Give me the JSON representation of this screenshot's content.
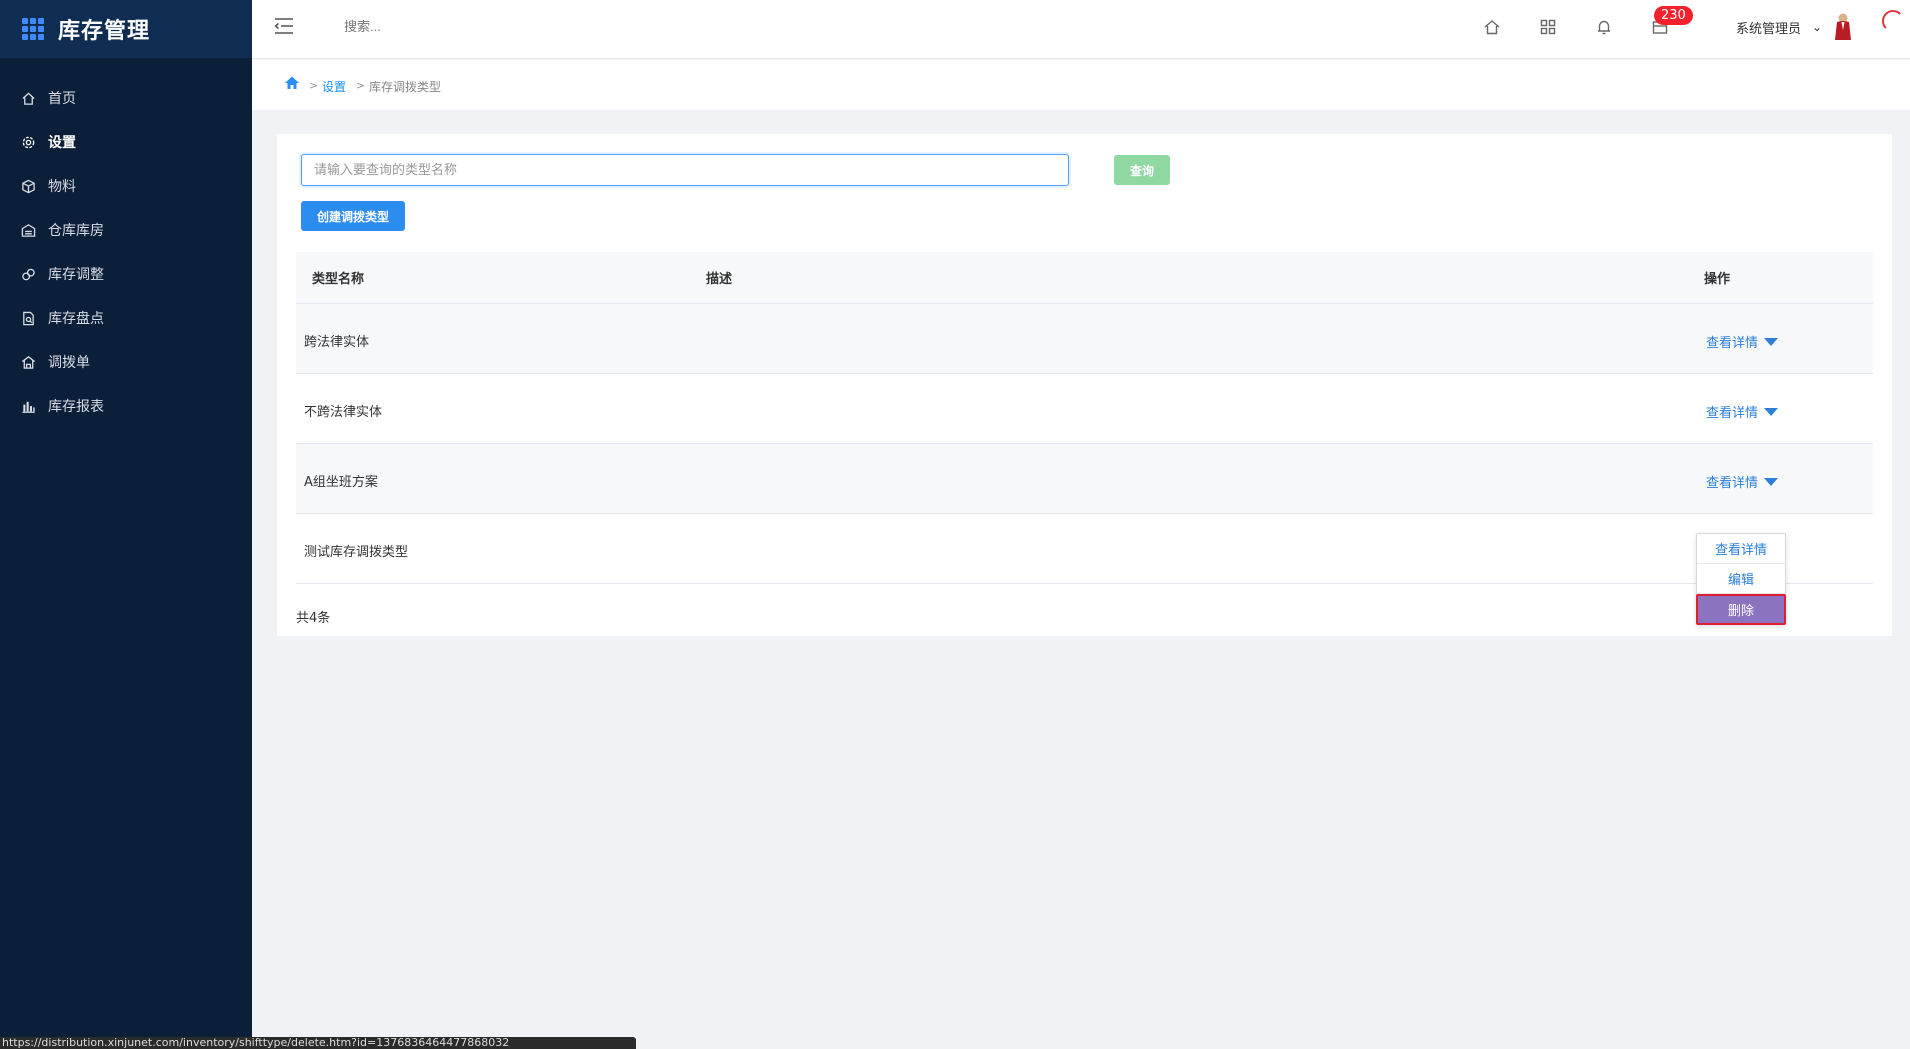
{
  "sidebar": {
    "title": "库存管理",
    "items": [
      {
        "label": "首页",
        "icon": "home-icon"
      },
      {
        "label": "设置",
        "icon": "gear-icon"
      },
      {
        "label": "物料",
        "icon": "box-icon"
      },
      {
        "label": "仓库库房",
        "icon": "warehouse-icon"
      },
      {
        "label": "库存调整",
        "icon": "adjust-icon"
      },
      {
        "label": "库存盘点",
        "icon": "inventory-check-icon"
      },
      {
        "label": "调拨单",
        "icon": "transfer-icon"
      },
      {
        "label": "库存报表",
        "icon": "bar-chart-icon"
      }
    ],
    "active_index": 1
  },
  "header": {
    "search_placeholder": "搜索...",
    "notification_count": "230",
    "user_name": "系统管理员"
  },
  "breadcrumb": {
    "items": [
      "设置",
      "库存调拨类型"
    ],
    "separator": ">"
  },
  "main": {
    "search_placeholder": "请输入要查询的类型名称",
    "search_value": "",
    "query_label": "查询",
    "create_label": "创建调拨类型",
    "table": {
      "headers": {
        "name": "类型名称",
        "description": "描述",
        "actions": "操作"
      },
      "rows": [
        {
          "name": "跨法律实体",
          "description": "",
          "action": "查看详情"
        },
        {
          "name": "不跨法律实体",
          "description": "",
          "action": "查看详情"
        },
        {
          "name": "A组坐班方案",
          "description": "",
          "action": "查看详情"
        },
        {
          "name": "测试库存调拨类型",
          "description": "",
          "action": "查看详情"
        }
      ]
    },
    "total": "共4条",
    "dropdown": {
      "items": [
        "查看详情",
        "编辑",
        "删除"
      ]
    }
  },
  "status_bar": "https://distribution.xinjunet.com/inventory/shifttype/delete.htm?id=1376836464477868032",
  "colors": {
    "sidebar_bg": "#0b1f38",
    "brand_bg": "#0f2d52",
    "primary": "#2d8cf0",
    "query_button": "#8fd8a2",
    "badge": "#f5222d",
    "delete_bg": "#8b73c0",
    "link": "#2d7fd8"
  }
}
